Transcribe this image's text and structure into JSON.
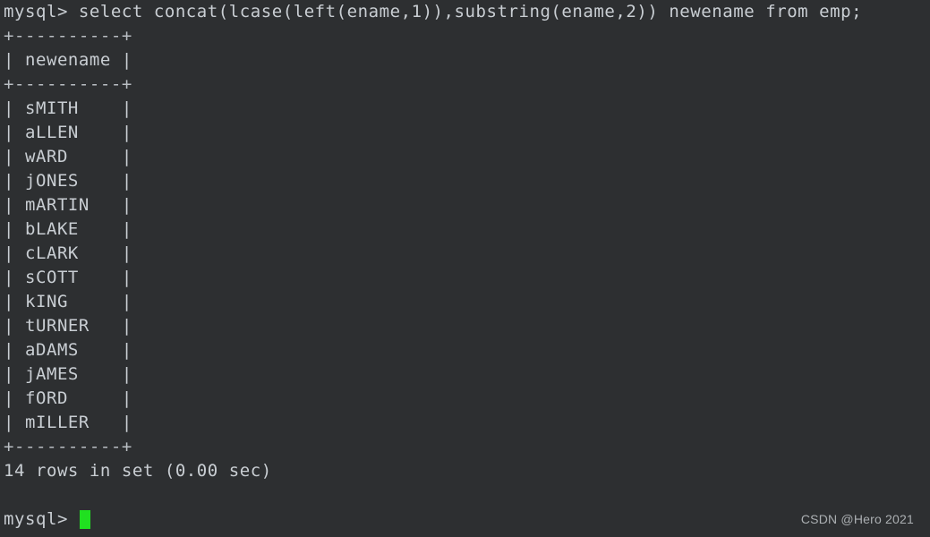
{
  "terminal": {
    "background_color": "#2d2f31",
    "text_color": "#c9ced3",
    "cursor_color": "#20e020",
    "prompt": "mysql> ",
    "command": "select concat(lcase(left(ename,1)),substring(ename,2)) newename from emp;",
    "command_full_line": "mysql> select concat(lcase(left(ename,1)),substring(ename,2)) newename from emp;"
  },
  "result_table": {
    "top_rule": "+----------+",
    "header_row": "| newename |",
    "header_separator": "+----------+",
    "bottom_rule": "+----------+",
    "column_header": "newename",
    "rows": [
      "| sMITH    |",
      "| aLLEN    |",
      "| wARD     |",
      "| jONES    |",
      "| mARTIN   |",
      "| bLAKE    |",
      "| cLARK    |",
      "| sCOTT    |",
      "| kING     |",
      "| tURNER   |",
      "| aDAMS    |",
      "| jAMES    |",
      "| fORD     |",
      "| mILLER   |"
    ],
    "values": [
      "sMITH",
      "aLLEN",
      "wARD",
      "jONES",
      "mARTIN",
      "bLAKE",
      "cLARK",
      "sCOTT",
      "kING",
      "tURNER",
      "aDAMS",
      "jAMES",
      "fORD",
      "mILLER"
    ]
  },
  "status": {
    "text": "14 rows in set (0.00 sec)",
    "row_count": 14,
    "elapsed": "0.00 sec"
  },
  "final_prompt": {
    "prompt": "mysql> ",
    "input": ""
  },
  "watermark": {
    "text": "CSDN @Hero 2021"
  }
}
